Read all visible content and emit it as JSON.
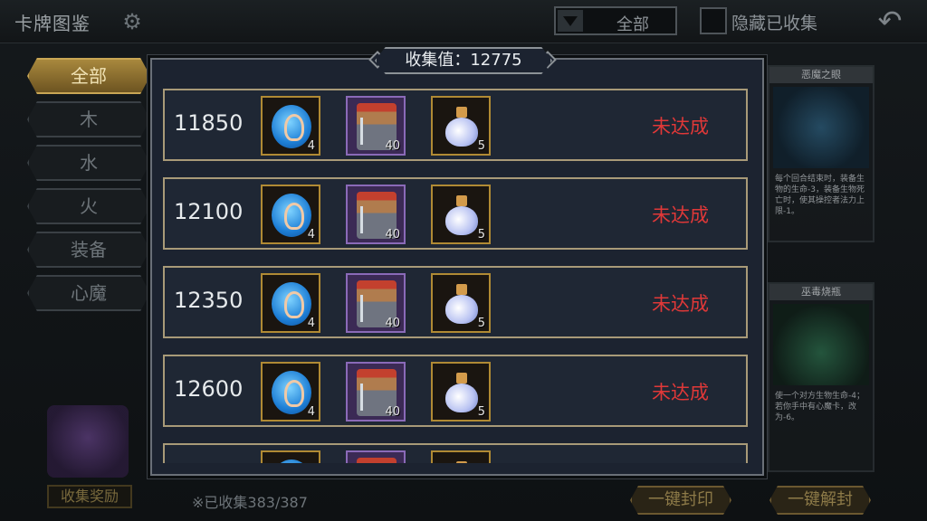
{
  "header": {
    "title": "卡牌图鉴",
    "filter_value": "全部",
    "hide_collected_label": "隐藏已收集"
  },
  "tabs": [
    {
      "label": "全部",
      "active": true
    },
    {
      "label": "木"
    },
    {
      "label": "水"
    },
    {
      "label": "火"
    },
    {
      "label": "装备"
    },
    {
      "label": "心魔"
    }
  ],
  "footer": {
    "chest_button": "收集奖励",
    "collected_text": "※已收集383/387",
    "seal_all": "一键封印",
    "unseal_all": "一键解封"
  },
  "cards": [
    {
      "name": "恶魔之眼",
      "text": "每个回合结束时，装备生物的生命-3，装备生物死亡时，使其操控者法力上限-1。"
    },
    {
      "name": "巫毒烧瓶",
      "text": "使一个对方生物生命-4；若你手中有心魔卡，改为-6。"
    }
  ],
  "modal": {
    "score_label": "收集值：12775",
    "rows": [
      {
        "threshold": "11850",
        "items": [
          {
            "icon": "blue-drop-icon",
            "count": "4"
          },
          {
            "icon": "hero-card-icon",
            "count": "40"
          },
          {
            "icon": "potion-flask-icon",
            "count": "5"
          }
        ],
        "status": "未达成"
      },
      {
        "threshold": "12100",
        "items": [
          {
            "icon": "blue-drop-icon",
            "count": "4"
          },
          {
            "icon": "hero-card-icon",
            "count": "40"
          },
          {
            "icon": "potion-flask-icon",
            "count": "5"
          }
        ],
        "status": "未达成"
      },
      {
        "threshold": "12350",
        "items": [
          {
            "icon": "blue-drop-icon",
            "count": "4"
          },
          {
            "icon": "hero-card-icon",
            "count": "40"
          },
          {
            "icon": "potion-flask-icon",
            "count": "5"
          }
        ],
        "status": "未达成"
      },
      {
        "threshold": "12600",
        "items": [
          {
            "icon": "blue-drop-icon",
            "count": "4"
          },
          {
            "icon": "hero-card-icon",
            "count": "40"
          },
          {
            "icon": "potion-flask-icon",
            "count": "5"
          }
        ],
        "status": "未达成"
      },
      {
        "threshold": "",
        "items": [
          {
            "icon": "blue-drop-icon",
            "count": ""
          },
          {
            "icon": "hero-card-icon",
            "count": ""
          },
          {
            "icon": "potion-flask-icon",
            "count": ""
          }
        ],
        "status": ""
      }
    ]
  },
  "colors": {
    "status_red": "#e03838",
    "gold_border": "#b08a34",
    "purple_border": "#8a6ab8"
  }
}
